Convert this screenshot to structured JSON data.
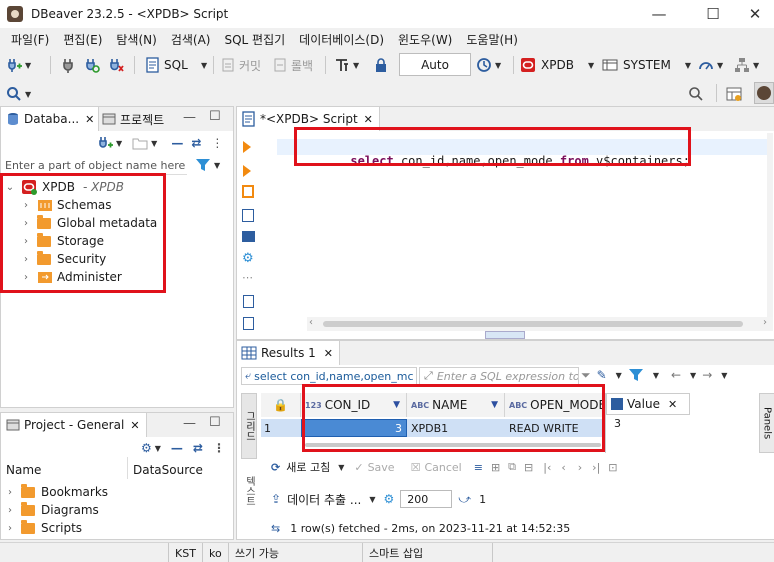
{
  "window": {
    "title": "DBeaver 23.2.5 - <XPDB> Script",
    "minimize": "—",
    "maximize": "☐",
    "close": "✕"
  },
  "menu": [
    "파일(F)",
    "편집(E)",
    "탐색(N)",
    "검색(A)",
    "SQL 편집기",
    "데이터베이스(D)",
    "윈도우(W)",
    "도움말(H)"
  ],
  "toolbar": {
    "sql_label": "SQL",
    "commit_label": "커밋",
    "rollback_label": "롤백",
    "auto_label": "Auto",
    "connection_label": "XPDB",
    "schema_label": "SYSTEM"
  },
  "navigator": {
    "tab_database": "Databa...",
    "tab_project": "프로젝트",
    "filter_placeholder": "Enter a part of object name here",
    "connection": {
      "name": "XPDB",
      "subtitle": "- XPDB"
    },
    "items": [
      "Schemas",
      "Global metadata",
      "Storage",
      "Security",
      "Administer"
    ]
  },
  "project": {
    "tab": "Project - General",
    "col_name": "Name",
    "col_datasource": "DataSource",
    "items": [
      "Bookmarks",
      "Diagrams",
      "Scripts"
    ]
  },
  "editor": {
    "tab": "*<XPDB> Script",
    "query": [
      {
        "t": "select",
        "k": true
      },
      {
        "t": " con_id,name,open_mode ",
        "k": false
      },
      {
        "t": "from",
        "k": true
      },
      {
        "t": " v$containers;",
        "k": false
      }
    ]
  },
  "results": {
    "tab": "Results 1",
    "filter_text": "select con_id,name,open_mc",
    "filter_placeholder": "Enter a SQL expression to",
    "side_label": "그리드",
    "side_label2": "텍스트",
    "columns": [
      {
        "type": "123",
        "name": "CON_ID"
      },
      {
        "type": "ABC",
        "name": "NAME"
      },
      {
        "type": "ABC",
        "name": "OPEN_MODE"
      }
    ],
    "rows": [
      {
        "num": "1",
        "con_id": "3",
        "name": "XPDB1",
        "open_mode": "READ WRITE"
      }
    ],
    "value_tab": "Value",
    "value_content": "3",
    "panels_label": "Panels",
    "refresh_label": "새로 고침",
    "save_label": "Save",
    "cancel_label": "Cancel",
    "export_label": "데이터 추출 ...",
    "fetch_size": "200",
    "row_count": "1",
    "status": "1 row(s) fetched - 2ms, on 2023-11-21 at 14:52:35"
  },
  "statusbar": {
    "timezone": "KST",
    "locale": "ko",
    "mode": "쓰기 가능",
    "insert": "스마트 삽입"
  },
  "colors": {
    "highlight_red": "#e0121b",
    "folder_orange": "#f29a2e",
    "keyword": "#7a0f5c",
    "selection": "#cfe0f5"
  }
}
